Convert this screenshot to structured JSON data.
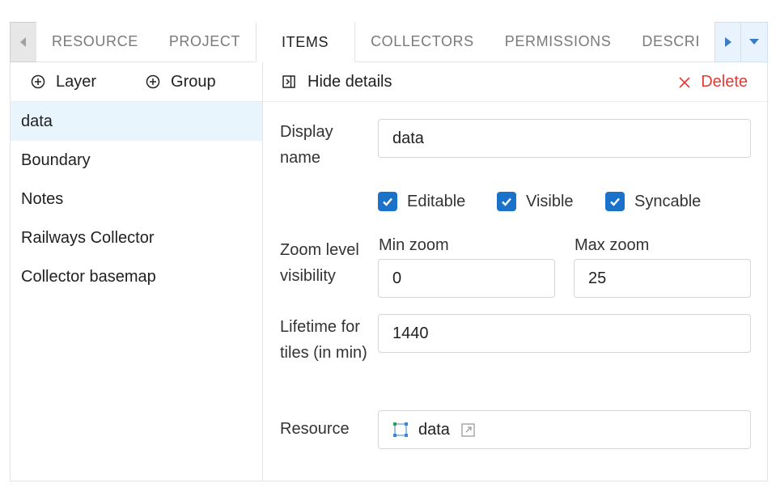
{
  "tabs": [
    {
      "label": "RESOURCE",
      "active": false
    },
    {
      "label": "PROJECT",
      "active": false
    },
    {
      "label": "ITEMS",
      "active": true
    },
    {
      "label": "COLLECTORS",
      "active": false
    },
    {
      "label": "PERMISSIONS",
      "active": false
    },
    {
      "label": "DESCRI",
      "active": false
    }
  ],
  "left_toolbar": {
    "layer_label": "Layer",
    "group_label": "Group"
  },
  "items": [
    "data",
    "Boundary",
    "Notes",
    "Railways Collector",
    "Collector basemap"
  ],
  "selected_item": "data",
  "right_toolbar": {
    "hide_label": "Hide details",
    "delete_label": "Delete"
  },
  "form": {
    "display_name_label": "Display name",
    "display_name_value": "data",
    "editable_label": "Editable",
    "visible_label": "Visible",
    "syncable_label": "Syncable",
    "zoom_label": "Zoom level visibility",
    "min_zoom_label": "Min zoom",
    "min_zoom_value": "0",
    "max_zoom_label": "Max zoom",
    "max_zoom_value": "25",
    "lifetime_label": "Lifetime for tiles (in min)",
    "lifetime_value": "1440",
    "resource_label": "Resource",
    "resource_value": "data"
  },
  "colors": {
    "accent": "#1a73c8",
    "danger": "#e53935",
    "selected_bg": "#e8f5fd"
  }
}
